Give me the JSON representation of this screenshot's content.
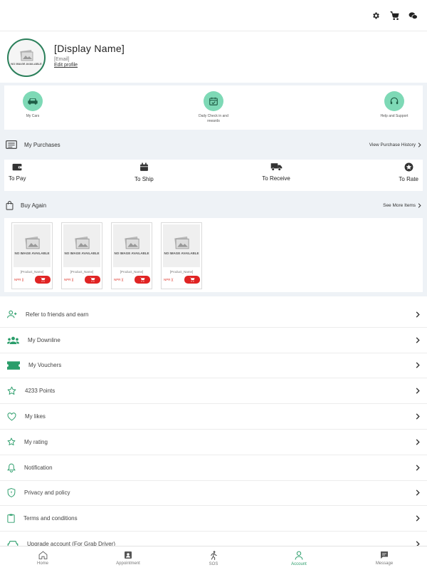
{
  "profile": {
    "display_name": "[Display Name]",
    "email": "[Email]",
    "edit_label": "Edit profile",
    "avatar_text": "NO IMAGE AVAILABLE"
  },
  "features": [
    {
      "label": "My Cars"
    },
    {
      "label": "Daily Check in and rewards"
    },
    {
      "label": "Help and Support"
    }
  ],
  "purchases": {
    "title": "My Purchases",
    "link": "View Purchase History",
    "orders": [
      {
        "label": "To Pay"
      },
      {
        "label": "To Ship"
      },
      {
        "label": "To Receive"
      },
      {
        "label": "To Rate"
      }
    ]
  },
  "buy_again": {
    "title": "Buy Again",
    "link": "See More Items",
    "cards": [
      {
        "noimg": "NO IMAGE AVAILABLE",
        "name": "[Product_Name]",
        "price": "NPR [("
      },
      {
        "noimg": "NO IMAGE AVAILABLE",
        "name": "[Product_Name]",
        "price": "NPR [("
      },
      {
        "noimg": "NO IMAGE AVAILABLE",
        "name": "[Product_Name]",
        "price": "NPR [("
      },
      {
        "noimg": "NO IMAGE AVAILABLE",
        "name": "[Product_Name]",
        "price": "NPR [("
      }
    ]
  },
  "menu": [
    {
      "label": "Refer to friends and earn"
    },
    {
      "label": "My Downline"
    },
    {
      "label": "My Vouchers"
    },
    {
      "label": "4233 Points"
    },
    {
      "label": "My likes"
    },
    {
      "label": "My rating"
    },
    {
      "label": "Notification"
    },
    {
      "label": "Privacy and policy"
    },
    {
      "label": "Terms and conditions"
    },
    {
      "label": "Upgrade account (For Grab Driver)"
    }
  ],
  "nav": [
    {
      "label": "Home"
    },
    {
      "label": "Appointment"
    },
    {
      "label": "SOS"
    },
    {
      "label": "Account"
    },
    {
      "label": "Message"
    }
  ],
  "colors": {
    "accent": "#2a9d6a",
    "feature_circle": "#7ed9b6",
    "cart_red": "#e02424",
    "section_bg": "#eef2f6"
  }
}
